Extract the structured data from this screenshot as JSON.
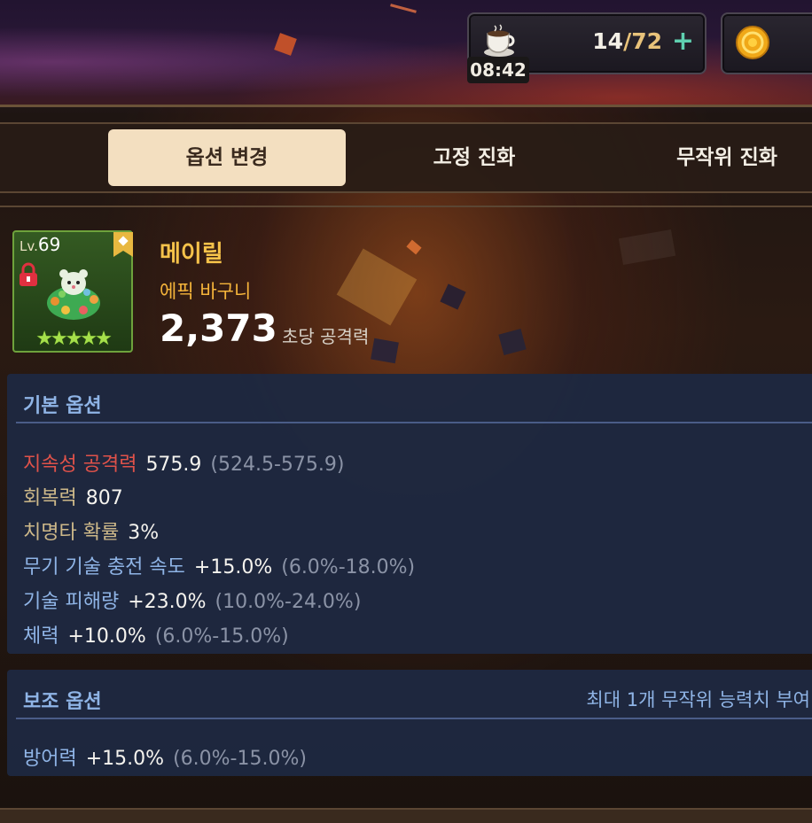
{
  "resources": {
    "stamina_current": "14",
    "stamina_sep": "/",
    "stamina_max": "72",
    "plus_label": "+",
    "timer": "08:42",
    "stamina_icon": "coffee-cup-icon",
    "coin_icon": "gold-coin-icon"
  },
  "tabs": [
    {
      "label": "옵션 변경",
      "active": true
    },
    {
      "label": "고정 진화",
      "active": false
    },
    {
      "label": "무작위 진화",
      "active": false
    }
  ],
  "hero": {
    "level_prefix": "Lv.",
    "level": "69",
    "name": "메이릴",
    "rarity": "에픽 바구니",
    "power": "2,373",
    "power_label": "초당 공격력",
    "stars": "★★★★★",
    "star_count": 5,
    "locked": true
  },
  "basic_options": {
    "header": "기본 옵션",
    "rows": [
      {
        "name": "지속성 공격력",
        "value": "575.9",
        "range": "(524.5-575.9)",
        "color": "red"
      },
      {
        "name": "회복력",
        "value": "807",
        "range": "",
        "color": "gold"
      },
      {
        "name": "치명타 확률",
        "value": "3%",
        "range": "",
        "color": "gold"
      },
      {
        "name": "무기 기술 충전 속도",
        "value": "+15.0%",
        "range": "(6.0%-18.0%)",
        "color": "blue"
      },
      {
        "name": "기술 피해량",
        "value": "+23.0%",
        "range": "(10.0%-24.0%)",
        "color": "blue"
      },
      {
        "name": "체력",
        "value": "+10.0%",
        "range": "(6.0%-15.0%)",
        "color": "blue"
      }
    ]
  },
  "sub_options": {
    "header": "보조 옵션",
    "note": "최대 1개 무작위 능력치 부여",
    "rows": [
      {
        "name": "방어력",
        "value": "+15.0%",
        "range": "(6.0%-15.0%)",
        "color": "blue"
      }
    ]
  },
  "colors": {
    "accent_gold": "#f5c24a",
    "option_blue": "#8fb4e6",
    "option_red": "#e0524a",
    "tab_active_bg": "#f3dfc0"
  }
}
